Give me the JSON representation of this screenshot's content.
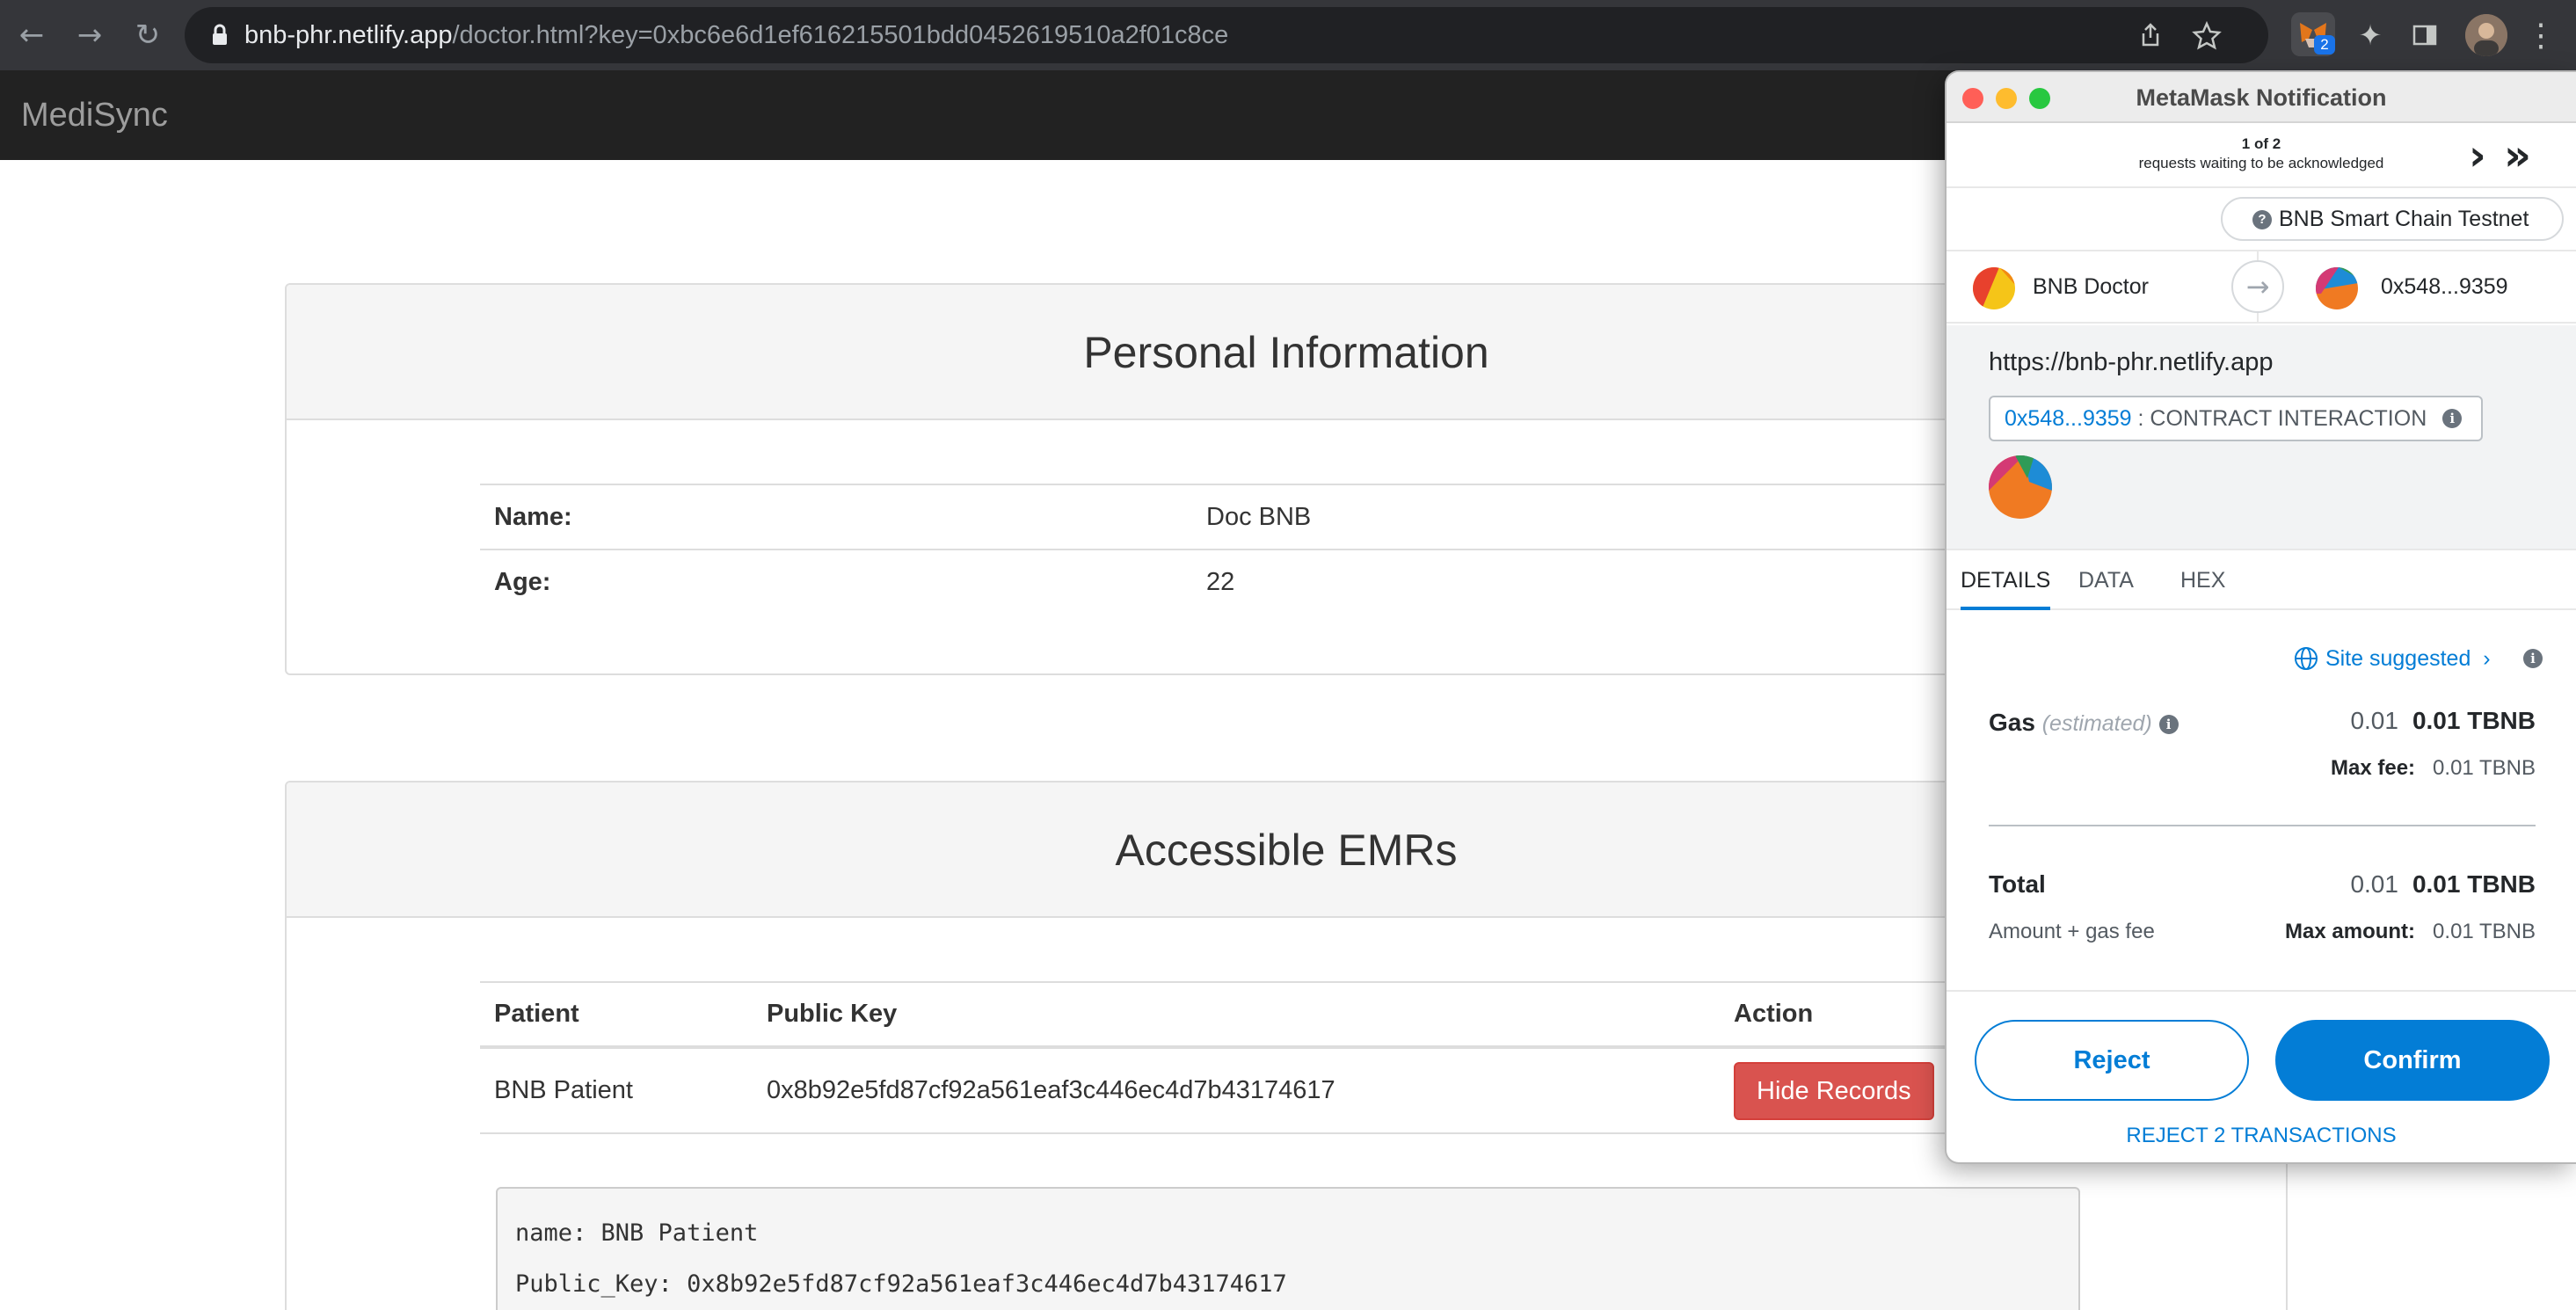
{
  "browser": {
    "url_host": "bnb-phr.netlify.app",
    "url_path": "/doctor.html?key=0xbc6e6d1ef616215501bdd0452619510a2f01c8ce",
    "extension_badge": "2",
    "accent_color": "#1a73e8"
  },
  "app": {
    "brand": "MediSync"
  },
  "personal_info": {
    "title": "Personal Information",
    "rows": [
      {
        "label": "Name:",
        "value": "Doc BNB"
      },
      {
        "label": "Age:",
        "value": "22"
      }
    ]
  },
  "emrs": {
    "title": "Accessible EMRs",
    "headers": {
      "patient": "Patient",
      "public_key": "Public Key",
      "action": "Action"
    },
    "rows": [
      {
        "patient": "BNB Patient",
        "public_key": "0x8b92e5fd87cf92a561eaf3c446ec4d7b43174617",
        "action": "Hide Records"
      }
    ],
    "record_lines": [
      "name: BNB Patient",
      "Public_Key: 0x8b92e5fd87cf92a561eaf3c446ec4d7b43174617"
    ],
    "action_color": "#d9534f"
  },
  "metamask": {
    "title": "MetaMask Notification",
    "queue_count": "1 of 2",
    "queue_text": "requests waiting to be acknowledged",
    "network": "BNB Smart Chain Testnet",
    "network_icon": "question-icon",
    "from_account": "BNB Doctor",
    "to_account": "0x548...9359",
    "origin": "https://bnb-phr.netlify.app",
    "contract_address": "0x548...9359",
    "contract_label": ": CONTRACT INTERACTION",
    "tabs": [
      "DETAILS",
      "DATA",
      "HEX"
    ],
    "active_tab": "DETAILS",
    "site_suggested": "Site suggested",
    "gas": {
      "label": "Gas",
      "estimated": "(estimated)",
      "value_light": "0.01",
      "value_bold": "0.01 TBNB",
      "max_fee_label": "Max fee:",
      "max_fee_value": "0.01 TBNB"
    },
    "total": {
      "label": "Total",
      "sub": "Amount + gas fee",
      "value_light": "0.01",
      "value_bold": "0.01 TBNB",
      "max_amount_label": "Max amount:",
      "max_amount_value": "0.01 TBNB"
    },
    "buttons": {
      "reject": "Reject",
      "confirm": "Confirm",
      "reject_all": "REJECT 2 TRANSACTIONS"
    },
    "primary_color": "#037dd6"
  }
}
